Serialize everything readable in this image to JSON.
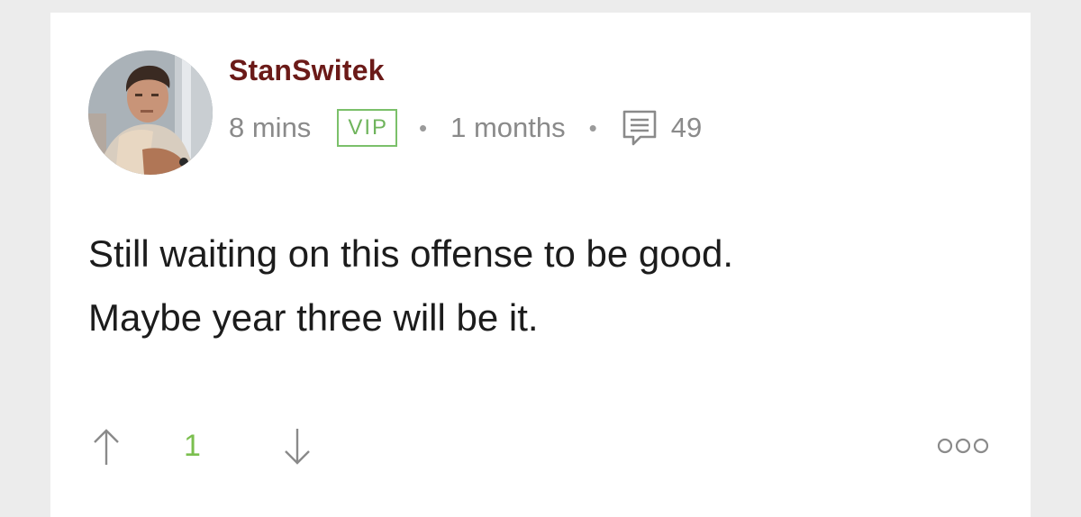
{
  "comment": {
    "username": "StanSwitek",
    "time": "8 mins",
    "badge": "VIP",
    "separator": "•",
    "member_duration": "1 months",
    "comment_count": "49",
    "body_lines": [
      "Still waiting on this offense to be good.",
      "Maybe year three will be it."
    ],
    "score": "1"
  },
  "icons": {
    "avatar": "user-avatar-photo",
    "comment": "comment-bubble-icon",
    "upvote": "arrow-up-icon",
    "downvote": "arrow-down-icon",
    "more": "more-options-icon"
  },
  "colors": {
    "username": "#6b1a18",
    "vip_badge": "#7bc06a",
    "score": "#7bbf4f",
    "meta_text": "#8a8a8a",
    "body_text": "#1c1c1c"
  }
}
